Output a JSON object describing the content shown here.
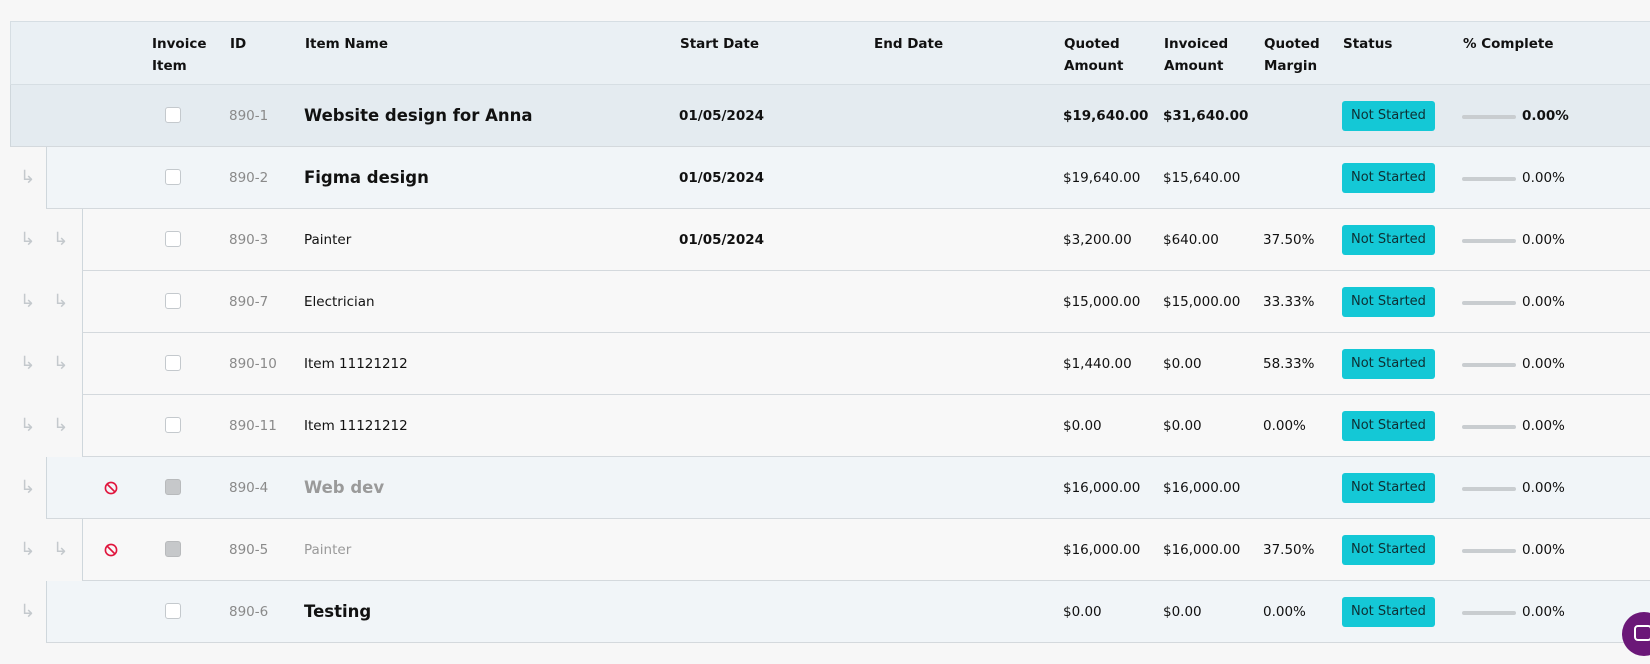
{
  "columns": {
    "invoice_item": "Invoice Item",
    "id": "ID",
    "item_name": "Item Name",
    "start_date": "Start Date",
    "end_date": "End Date",
    "quoted_amount": "Quoted Amount",
    "invoiced_amount": "Invoiced Amount",
    "quoted_margin": "Quoted Margin",
    "status": "Status",
    "pct_complete": "% Complete"
  },
  "rows": [
    {
      "level": 0,
      "id": "890-1",
      "name": "Website design for Anna",
      "start": "01/05/2024",
      "end": "",
      "quoted": "$19,640.00",
      "invoiced": "$31,640.00",
      "margin": "",
      "status": "Not Started",
      "pct": "0.00%",
      "disabled": false
    },
    {
      "level": 1,
      "id": "890-2",
      "name": "Figma design",
      "start": "01/05/2024",
      "end": "",
      "quoted": "$19,640.00",
      "invoiced": "$15,640.00",
      "margin": "",
      "status": "Not Started",
      "pct": "0.00%",
      "disabled": false
    },
    {
      "level": 2,
      "id": "890-3",
      "name": "Painter",
      "start": "01/05/2024",
      "end": "",
      "quoted": "$3,200.00",
      "invoiced": "$640.00",
      "margin": "37.50%",
      "status": "Not Started",
      "pct": "0.00%",
      "disabled": false
    },
    {
      "level": 2,
      "id": "890-7",
      "name": "Electrician",
      "start": "",
      "end": "",
      "quoted": "$15,000.00",
      "invoiced": "$15,000.00",
      "margin": "33.33%",
      "status": "Not Started",
      "pct": "0.00%",
      "disabled": false
    },
    {
      "level": 2,
      "id": "890-10",
      "name": "Item 11121212",
      "start": "",
      "end": "",
      "quoted": "$1,440.00",
      "invoiced": "$0.00",
      "margin": "58.33%",
      "status": "Not Started",
      "pct": "0.00%",
      "disabled": false
    },
    {
      "level": 2,
      "id": "890-11",
      "name": "Item 11121212",
      "start": "",
      "end": "",
      "quoted": "$0.00",
      "invoiced": "$0.00",
      "margin": "0.00%",
      "status": "Not Started",
      "pct": "0.00%",
      "disabled": false
    },
    {
      "level": 1,
      "id": "890-4",
      "name": "Web dev",
      "start": "",
      "end": "",
      "quoted": "$16,000.00",
      "invoiced": "$16,000.00",
      "margin": "",
      "status": "Not Started",
      "pct": "0.00%",
      "disabled": true
    },
    {
      "level": 2,
      "id": "890-5",
      "name": "Painter",
      "start": "",
      "end": "",
      "quoted": "$16,000.00",
      "invoiced": "$16,000.00",
      "margin": "37.50%",
      "status": "Not Started",
      "pct": "0.00%",
      "disabled": true
    },
    {
      "level": 1,
      "id": "890-6",
      "name": "Testing",
      "start": "",
      "end": "",
      "quoted": "$0.00",
      "invoiced": "$0.00",
      "margin": "0.00%",
      "status": "Not Started",
      "pct": "0.00%",
      "disabled": false
    }
  ],
  "colors": {
    "status_badge": "#14c8d6",
    "disabled_icon": "#e0143c",
    "chat_button": "#6b1878"
  },
  "icons": {
    "child_indent": "subdirectory-arrow-icon",
    "disabled": "ban-icon",
    "chat": "chat-icon"
  }
}
